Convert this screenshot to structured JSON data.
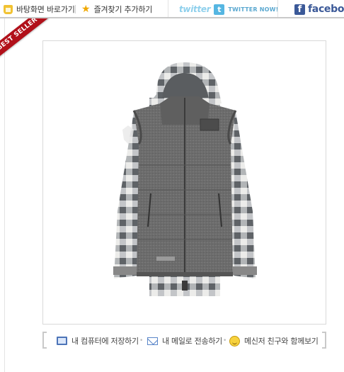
{
  "toolbar": {
    "desktop_shortcut_label": "바탕화면 바로가기",
    "bookmark_label": "즐겨찾기 추가하기",
    "twitter_word": "twitter",
    "twitter_button_label": "TWITTER NOW!",
    "facebook_label": "facebook",
    "twitter_color": "#55b6e2",
    "facebook_color": "#3b5998"
  },
  "badge": {
    "ribbon_text": "BEST SELLER",
    "ribbon_color": "#b1101a"
  },
  "product": {
    "image_subject": "gray down vest with hood over gray-white plaid shirt",
    "vest_logo_text": "ELNATH"
  },
  "actions": {
    "save_to_pc_label": "내 컴퓨터에 저장하기",
    "send_email_label": "내 메일로 전송하기",
    "messenger_label": "메신저 친구와 함께보기"
  }
}
